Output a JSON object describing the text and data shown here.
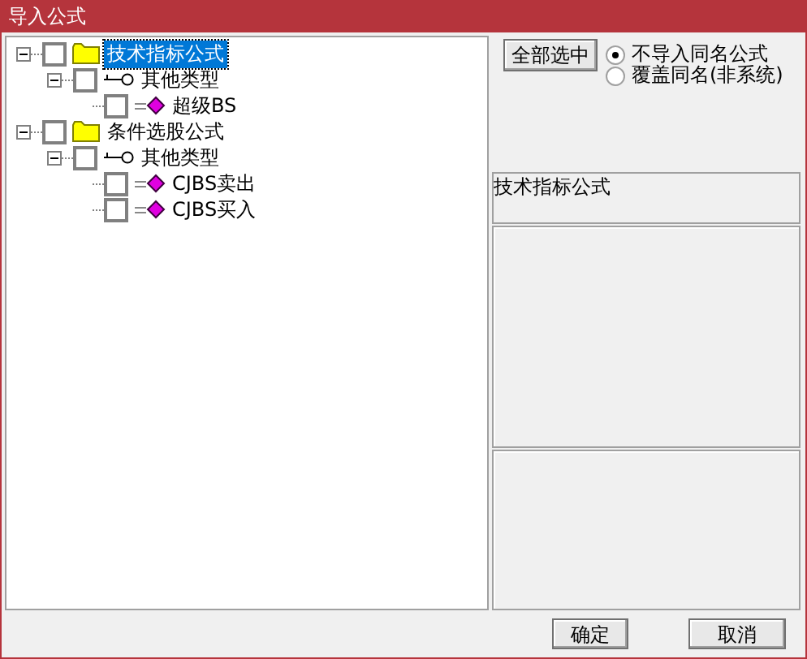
{
  "window": {
    "title": "导入公式"
  },
  "tree": [
    {
      "label": "技术指标公式",
      "kind": "folder",
      "checked": false,
      "selected": true,
      "expanded": true,
      "children": [
        {
          "label": "其他类型",
          "kind": "key",
          "checked": false,
          "selected": false,
          "expanded": true,
          "children": [
            {
              "label": "超级BS",
              "kind": "formula",
              "checked": false,
              "selected": false
            }
          ]
        }
      ]
    },
    {
      "label": "条件选股公式",
      "kind": "folder",
      "checked": false,
      "selected": false,
      "expanded": true,
      "children": [
        {
          "label": "其他类型",
          "kind": "key",
          "checked": false,
          "selected": false,
          "expanded": true,
          "children": [
            {
              "label": "CJBS卖出",
              "kind": "formula",
              "checked": false,
              "selected": false
            },
            {
              "label": "CJBS买入",
              "kind": "formula",
              "checked": false,
              "selected": false
            }
          ]
        }
      ]
    }
  ],
  "select_all_button": "全部选中",
  "options": [
    {
      "label": "不导入同名公式",
      "selected": true
    },
    {
      "label": "覆盖同名(非系统)",
      "selected": false
    }
  ],
  "description": "技术指标公式",
  "buttons": [
    "确定",
    "取消"
  ]
}
